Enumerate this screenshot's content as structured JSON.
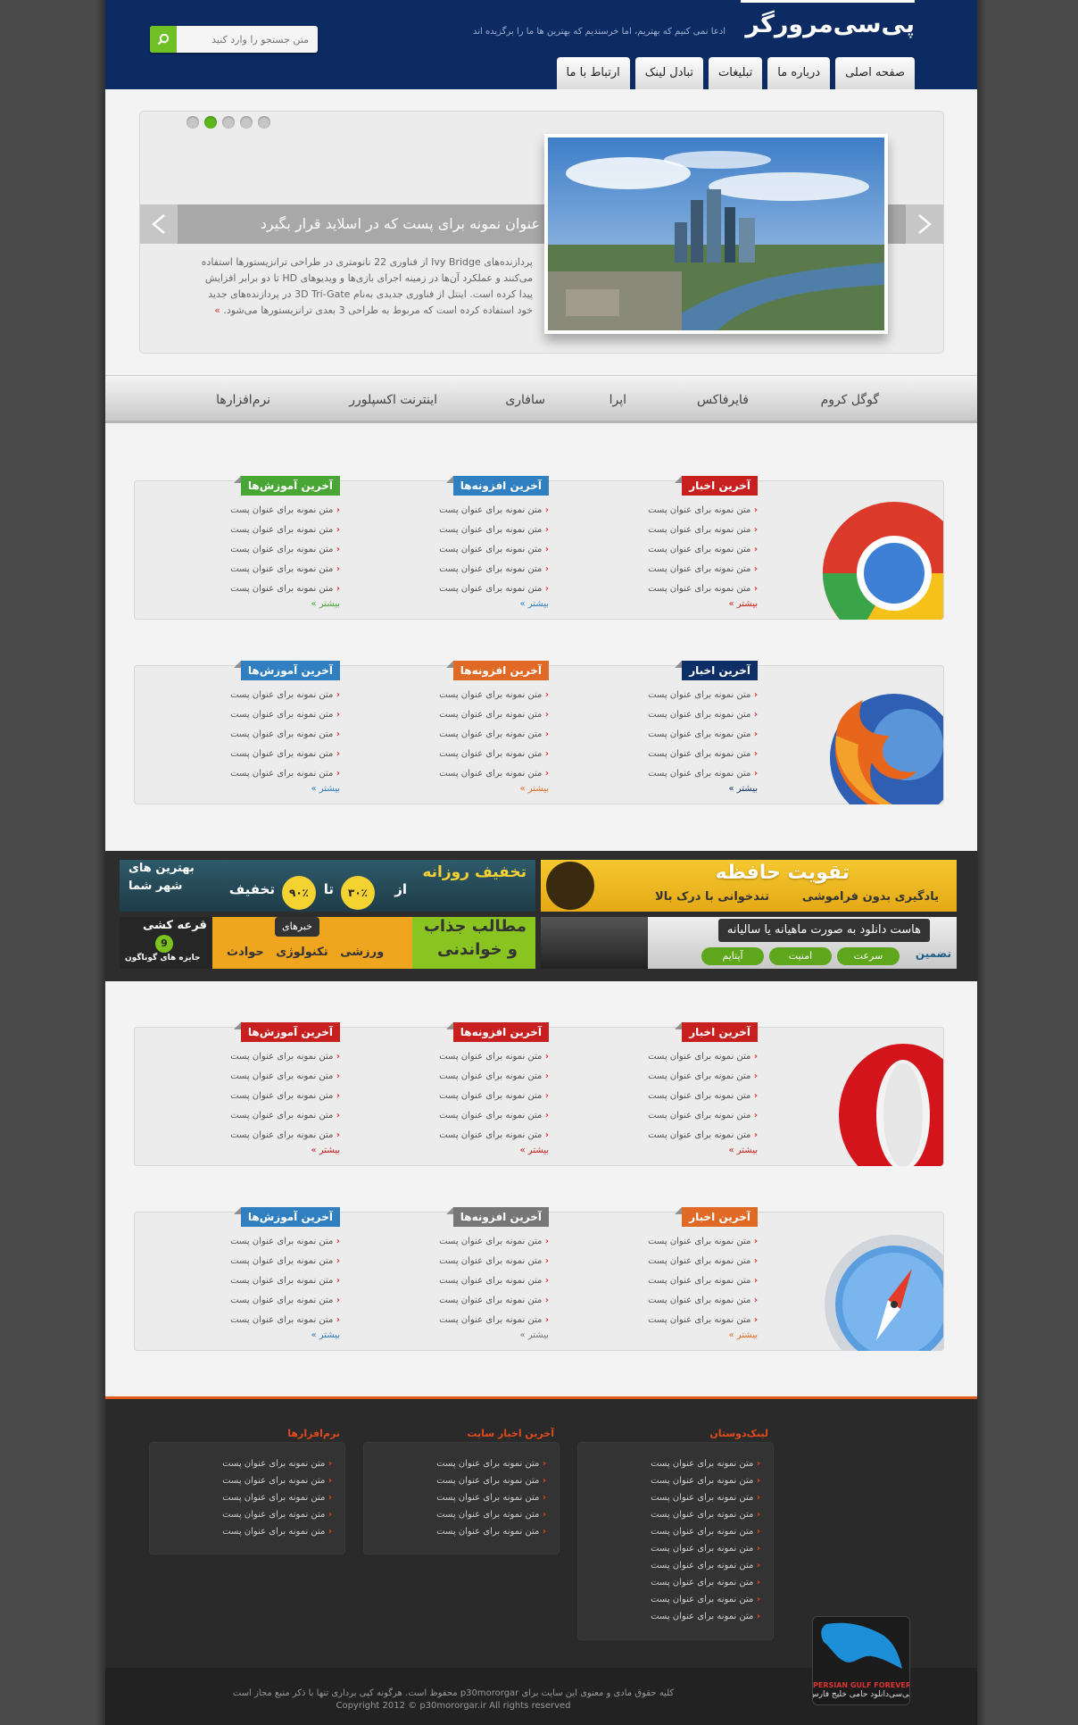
{
  "header": {
    "logo": "پی‌سی‌مرورگر",
    "tagline": "ادعا نمی کنیم که بهتریم، اما خرسندیم که بهترین ها ما را برگزیده اند",
    "search_placeholder": "متن جستجو را وارد کنید",
    "search_icon": "search-icon",
    "nav": [
      {
        "label": "صفحه اصلی"
      },
      {
        "label": "درباره ما"
      },
      {
        "label": "تبلیغات"
      },
      {
        "label": "تبادل لینک"
      },
      {
        "label": "ارتباط با ما"
      }
    ]
  },
  "slider": {
    "title": "عنوان نمونه برای پست که در اسلاید قرار بگیرد",
    "text": "پردازنده‌های Ivy Bridge از فناوری 22 نانومتری در طراحی ترانزیستورها استفاده می‌کنند و عملکرد آن‌ها در زمینه اجرای بازی‌ها و ویدیوهای HD تا دو برابر افزایش پیدا کرده است. اینتل از فناوری جدیدی به‌نام 3D Tri-Gate در پردازنده‌های جدید خود استفاده کرده است که مربوط به طراحی 3 بعدی ترانزیستورها می‌شود.",
    "more": "»",
    "active_dot": 2,
    "dots": 5
  },
  "browser_menu": [
    "گوگل کروم",
    "فایرفاکس",
    "اپرا",
    "سافاری",
    "اینترنت اکسپلورر",
    "نرم‌افزارها"
  ],
  "boxes": [
    {
      "logo": "chrome-logo",
      "cols": [
        {
          "title": "آخرین اخبار",
          "color": "#c8201f",
          "more_color": "#c8201f"
        },
        {
          "title": "آخرین افزونه‌ها",
          "color": "#2f7fc1",
          "more_color": "#2f7fc1"
        },
        {
          "title": "آخرین آموزش‌ها",
          "color": "#48a634",
          "more_color": "#48a634"
        }
      ]
    },
    {
      "logo": "firefox-logo",
      "cols": [
        {
          "title": "آخرین اخبار",
          "color": "#0e2e66",
          "more_color": "#0e2e66"
        },
        {
          "title": "آخرین افزونه‌ها",
          "color": "#e06a25",
          "more_color": "#e06a25"
        },
        {
          "title": "آخرین آموزش‌ها",
          "color": "#2f7fc1",
          "more_color": "#2f7fc1"
        }
      ]
    },
    {
      "logo": "opera-logo",
      "cols": [
        {
          "title": "آخرین اخبار",
          "color": "#c8201f",
          "more_color": "#c8201f"
        },
        {
          "title": "آخرین افزونه‌ها",
          "color": "#c8201f",
          "more_color": "#c8201f"
        },
        {
          "title": "آخرین آموزش‌ها",
          "color": "#c8201f",
          "more_color": "#c8201f"
        }
      ]
    },
    {
      "logo": "safari-logo",
      "cols": [
        {
          "title": "آخرین اخبار",
          "color": "#e06a25",
          "more_color": "#e06a25"
        },
        {
          "title": "آخرین افزونه‌ها",
          "color": "#777777",
          "more_color": "#777777"
        },
        {
          "title": "آخرین آموزش‌ها",
          "color": "#2f7fc1",
          "more_color": "#2f7fc1"
        }
      ]
    }
  ],
  "post_item": "متن نمونه برای عنوان پست",
  "more_label": "بیشتر »",
  "ads": {
    "memory_title": "تقویت حافظه",
    "memory_sub1": "تندخوانی با درک بالا",
    "memory_sub2": "یادگیری بدون فراموشی",
    "discount_title": "تخفیف روزانه",
    "discount_from": "از",
    "discount_pct1": "۳۰٪",
    "discount_to": "تا",
    "discount_pct2": "۹۰٪",
    "discount_word": "تخفیف",
    "discount_best": "بهترین های",
    "discount_city": "شهر شما",
    "host_title": "هاست دانلود به صورت ماهیانه یا سالیانه",
    "host_guarantee": "تضمین",
    "host_tags": [
      "سرعت",
      "امنیت",
      "آپتایم"
    ],
    "news_title": "مطالب جذاب",
    "news_sub": "و خواندنی",
    "news_badge": "خبرهای",
    "news_cats": "ورزشی   تکنولوژی   حوادث",
    "lottery_title": "قرعه کشی",
    "lottery_num": "9",
    "lottery_sub": "جایزه های گوناگون"
  },
  "footer": {
    "cols": [
      {
        "title": "لینک‌دوستان",
        "count": 10
      },
      {
        "title": "آخرین اخبار سایت",
        "count": 5
      },
      {
        "title": "نرم‌افزارها",
        "count": 5
      }
    ],
    "badge_label": "PERSIAN GULF FOREVER",
    "badge_text": "پی‌سی‌دانلود حامی خلیج فارس",
    "copyright_fa": "کلیه حقوق مادی و معنوی این سایت برای p30mororgar محفوظ است. هرگونه کپی برداری تنها با ذکر منبع مجاز است",
    "copyright_en": "Copyright 2012 © p30mororgar.ir All rights reserved"
  }
}
